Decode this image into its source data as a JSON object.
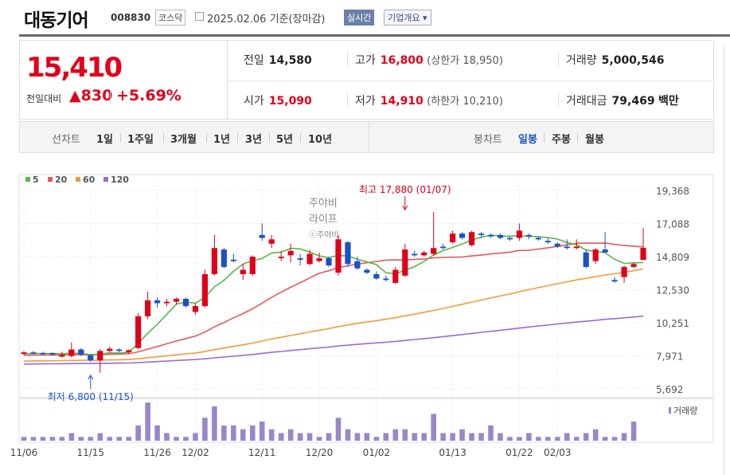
{
  "header": {
    "company_name": "대동기어",
    "stock_code": "008830",
    "market": "코스닥",
    "date_text": "2025.02.06 기준(장마감)",
    "realtime_label": "실시간",
    "company_info_label": "기업개요"
  },
  "price": {
    "current": "15,410",
    "change_label": "전일대비",
    "change_value": "830",
    "change_pct": "+5.69%"
  },
  "stats": {
    "prev_close_label": "전일",
    "prev_close": "14,580",
    "high_label": "고가",
    "high": "16,800",
    "upper_limit": "(상한가 18,950)",
    "volume_label": "거래량",
    "volume": "5,000,546",
    "open_label": "시가",
    "open": "15,090",
    "low_label": "저가",
    "low": "14,910",
    "lower_limit": "(하한가 10,210)",
    "amount_label": "거래대금",
    "amount": "79,469",
    "amount_unit": "백만"
  },
  "tabs": {
    "line_label": "선차트",
    "line_items": [
      "1일",
      "1주일",
      "3개월",
      "1년",
      "3년",
      "5년",
      "10년"
    ],
    "line_selected": "3개월",
    "candle_label": "봉차트",
    "candle_items": [
      "일봉",
      "주봉",
      "월봉"
    ],
    "candle_selected": "일봉"
  },
  "watermark": {
    "line1": "주야비",
    "line2": "라이프",
    "line3": "ⓒ주야비"
  },
  "colors": {
    "up": "#e0001b",
    "down": "#1a52c6",
    "ma5": "#5bb548",
    "ma20": "#e35a5a",
    "ma60": "#f29a3a",
    "ma120": "#9a6ad0",
    "volume": "#9b86c9"
  },
  "chart_data": {
    "type": "candlestick",
    "legend": [
      "5",
      "20",
      "60",
      "120"
    ],
    "y_ticks": [
      "19,368",
      "17,088",
      "14,809",
      "12,530",
      "10,251",
      "7,971",
      "5,692"
    ],
    "ylim": [
      5692,
      19368
    ],
    "x_tick_labels": [
      {
        "i": 0,
        "label": "11/06"
      },
      {
        "i": 7,
        "label": "11/15"
      },
      {
        "i": 14,
        "label": "11/26"
      },
      {
        "i": 18,
        "label": "12/02"
      },
      {
        "i": 25,
        "label": "12/11"
      },
      {
        "i": 31,
        "label": "12/20"
      },
      {
        "i": 37,
        "label": "01/02"
      },
      {
        "i": 45,
        "label": "01/13"
      },
      {
        "i": 52,
        "label": "01/22"
      },
      {
        "i": 56,
        "label": "02/03"
      }
    ],
    "volume_label": "거래량",
    "high_annotation": {
      "text": "최고 17,880 (01/07)",
      "index": 40,
      "value": 17880
    },
    "low_annotation": {
      "text": "최저 6,800 (11/15)",
      "index": 7,
      "value": 6800
    },
    "candles": [
      {
        "o": 8110,
        "h": 8310,
        "l": 8010,
        "c": 8210
      },
      {
        "o": 8210,
        "h": 8310,
        "l": 8060,
        "c": 8160
      },
      {
        "o": 8160,
        "h": 8260,
        "l": 8010,
        "c": 8110
      },
      {
        "o": 8160,
        "h": 8210,
        "l": 8010,
        "c": 8060
      },
      {
        "o": 7910,
        "h": 8260,
        "l": 7860,
        "c": 8060
      },
      {
        "o": 7960,
        "h": 8900,
        "l": 7860,
        "c": 8410
      },
      {
        "o": 8410,
        "h": 8510,
        "l": 7960,
        "c": 8060
      },
      {
        "o": 8010,
        "h": 8110,
        "l": 7560,
        "c": 7660
      },
      {
        "o": 7660,
        "h": 8450,
        "l": 6800,
        "c": 8310
      },
      {
        "o": 8310,
        "h": 8610,
        "l": 8210,
        "c": 8460
      },
      {
        "o": 8410,
        "h": 8510,
        "l": 8210,
        "c": 8310
      },
      {
        "o": 8210,
        "h": 8410,
        "l": 8110,
        "c": 8360
      },
      {
        "o": 8510,
        "h": 10900,
        "l": 8410,
        "c": 10700
      },
      {
        "o": 10700,
        "h": 12400,
        "l": 10500,
        "c": 11800
      },
      {
        "o": 11800,
        "h": 12000,
        "l": 11300,
        "c": 11600
      },
      {
        "o": 11600,
        "h": 11900,
        "l": 11400,
        "c": 11700
      },
      {
        "o": 11700,
        "h": 12000,
        "l": 11500,
        "c": 11900
      },
      {
        "o": 11900,
        "h": 12000,
        "l": 11300,
        "c": 11400
      },
      {
        "o": 11000,
        "h": 11600,
        "l": 10800,
        "c": 11400
      },
      {
        "o": 11400,
        "h": 13900,
        "l": 11300,
        "c": 13600
      },
      {
        "o": 13600,
        "h": 16300,
        "l": 13500,
        "c": 15400
      },
      {
        "o": 15300,
        "h": 15400,
        "l": 14000,
        "c": 14100
      },
      {
        "o": 14600,
        "h": 15000,
        "l": 14400,
        "c": 14500
      },
      {
        "o": 13600,
        "h": 14300,
        "l": 13200,
        "c": 13900
      },
      {
        "o": 13600,
        "h": 14900,
        "l": 13500,
        "c": 14800
      },
      {
        "o": 16300,
        "h": 17100,
        "l": 15900,
        "c": 16100
      },
      {
        "o": 15700,
        "h": 16300,
        "l": 15400,
        "c": 16000
      },
      {
        "o": 14700,
        "h": 15200,
        "l": 14500,
        "c": 14800
      },
      {
        "o": 14900,
        "h": 15700,
        "l": 14400,
        "c": 15200
      },
      {
        "o": 14700,
        "h": 15000,
        "l": 14200,
        "c": 14600
      },
      {
        "o": 14300,
        "h": 15300,
        "l": 14200,
        "c": 15000
      },
      {
        "o": 14500,
        "h": 15100,
        "l": 14400,
        "c": 14700
      },
      {
        "o": 14700,
        "h": 14800,
        "l": 14100,
        "c": 14200
      },
      {
        "o": 13700,
        "h": 16300,
        "l": 13500,
        "c": 16000
      },
      {
        "o": 15800,
        "h": 15900,
        "l": 14100,
        "c": 14300
      },
      {
        "o": 14500,
        "h": 14800,
        "l": 13900,
        "c": 14000
      },
      {
        "o": 13900,
        "h": 14000,
        "l": 13600,
        "c": 13700
      },
      {
        "o": 13600,
        "h": 13800,
        "l": 13200,
        "c": 13300
      },
      {
        "o": 13300,
        "h": 13500,
        "l": 13100,
        "c": 13200
      },
      {
        "o": 13000,
        "h": 14100,
        "l": 12900,
        "c": 13900
      },
      {
        "o": 13500,
        "h": 15700,
        "l": 13400,
        "c": 15300
      },
      {
        "o": 15000,
        "h": 15200,
        "l": 14800,
        "c": 14900
      },
      {
        "o": 14900,
        "h": 15200,
        "l": 14800,
        "c": 15100
      },
      {
        "o": 15000,
        "h": 17880,
        "l": 14900,
        "c": 15400
      },
      {
        "o": 15500,
        "h": 15700,
        "l": 15300,
        "c": 15400
      },
      {
        "o": 15800,
        "h": 16600,
        "l": 15700,
        "c": 16400
      },
      {
        "o": 16400,
        "h": 16500,
        "l": 16000,
        "c": 16100
      },
      {
        "o": 15600,
        "h": 16600,
        "l": 15500,
        "c": 16500
      },
      {
        "o": 16400,
        "h": 16500,
        "l": 16100,
        "c": 16300
      },
      {
        "o": 16300,
        "h": 16400,
        "l": 16100,
        "c": 16200
      },
      {
        "o": 16300,
        "h": 16400,
        "l": 16000,
        "c": 16100
      },
      {
        "o": 16100,
        "h": 16200,
        "l": 15900,
        "c": 16000
      },
      {
        "o": 16100,
        "h": 17100,
        "l": 15900,
        "c": 16600
      },
      {
        "o": 16300,
        "h": 16400,
        "l": 16000,
        "c": 16200
      },
      {
        "o": 16100,
        "h": 16200,
        "l": 15900,
        "c": 16000
      },
      {
        "o": 15900,
        "h": 16100,
        "l": 15700,
        "c": 15800
      },
      {
        "o": 15700,
        "h": 15800,
        "l": 15400,
        "c": 15500
      },
      {
        "o": 15500,
        "h": 16000,
        "l": 15300,
        "c": 15400
      },
      {
        "o": 15400,
        "h": 16000,
        "l": 15300,
        "c": 15500
      },
      {
        "o": 15100,
        "h": 15300,
        "l": 14000,
        "c": 14100
      },
      {
        "o": 14500,
        "h": 15400,
        "l": 14300,
        "c": 15300
      },
      {
        "o": 15300,
        "h": 16500,
        "l": 15100,
        "c": 15100
      },
      {
        "o": 13200,
        "h": 13400,
        "l": 13000,
        "c": 13100
      },
      {
        "o": 13400,
        "h": 14200,
        "l": 13000,
        "c": 14100
      },
      {
        "o": 14100,
        "h": 14400,
        "l": 14000,
        "c": 14300
      },
      {
        "o": 14580,
        "h": 16800,
        "l": 14910,
        "c": 15410
      }
    ],
    "volumes": [
      1,
      1,
      1,
      1,
      1,
      2,
      1,
      1,
      2,
      1,
      1,
      1,
      4,
      10,
      4,
      2,
      1,
      1,
      2,
      6,
      9,
      4,
      4,
      3,
      4,
      5,
      3,
      2,
      3,
      2,
      2,
      1,
      2,
      6,
      3,
      2,
      2,
      1,
      2,
      3,
      3,
      2,
      2,
      7,
      2,
      2,
      3,
      2,
      2,
      4,
      2,
      1,
      1,
      2,
      1,
      1,
      1,
      2,
      1,
      2,
      3,
      1,
      1,
      2,
      5
    ]
  }
}
